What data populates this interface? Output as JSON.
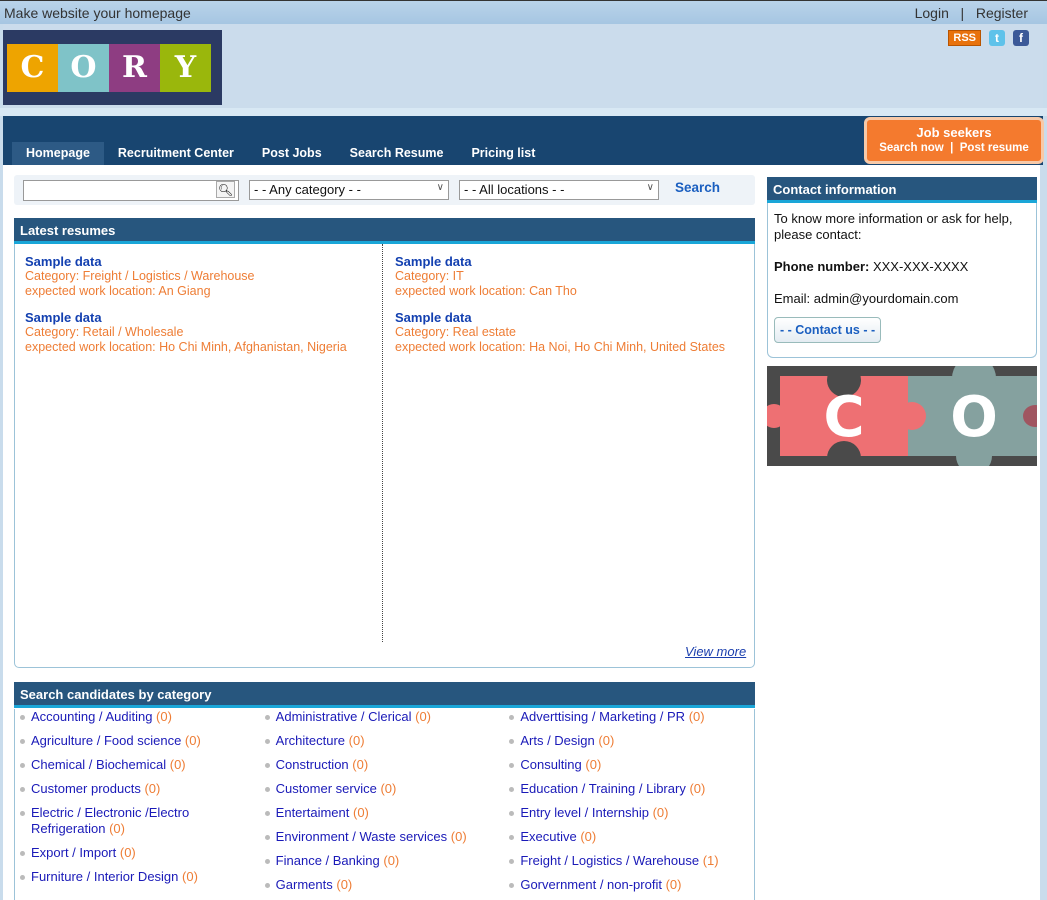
{
  "topbar": {
    "homepage_link": "Make website your homepage",
    "login": "Login",
    "separator": "|",
    "register": "Register"
  },
  "logo": {
    "letters": [
      "C",
      "O",
      "R",
      "Y"
    ],
    "colors": [
      "#eea400",
      "#7fc3c8",
      "#8e3d82",
      "#9ab70c"
    ]
  },
  "social": {
    "rss": "RSS",
    "twitter": "t",
    "facebook": "f"
  },
  "nav": {
    "tabs": [
      "Homepage",
      "Recruitment Center",
      "Post Jobs",
      "Search Resume",
      "Pricing list"
    ],
    "active": "Homepage"
  },
  "job_seekers": {
    "title": "Job seekers",
    "search_now": "Search now",
    "separator": "|",
    "post_resume": "Post resume"
  },
  "search": {
    "keyword_value": "",
    "category": "- - Any category - -",
    "location": "- - All locations - -",
    "button": "Search"
  },
  "latest_resumes": {
    "title": "Latest resumes",
    "items": [
      {
        "name": "Sample data",
        "category": "Category: Freight / Logistics / Warehouse",
        "location": "expected work location: An Giang"
      },
      {
        "name": "Sample data",
        "category": "Category: IT",
        "location": "expected work location: Can Tho"
      },
      {
        "name": "Sample data",
        "category": "Category: Retail / Wholesale",
        "location": "expected work location: Ho Chi Minh, Afghanistan, Nigeria"
      },
      {
        "name": "Sample data",
        "category": "Category: Real estate",
        "location": "expected work location: Ha Noi, Ho Chi Minh, United States"
      }
    ],
    "view_more": "View more"
  },
  "categories": {
    "title": "Search candidates by category",
    "columns": [
      [
        {
          "name": "Accounting / Auditing",
          "count": "(0)"
        },
        {
          "name": "Agriculture / Food science",
          "count": "(0)"
        },
        {
          "name": "Chemical / Biochemical",
          "count": "(0)"
        },
        {
          "name": "Customer products",
          "count": "(0)"
        },
        {
          "name": "Electric / Electronic /Electro Refrigeration",
          "count": "(0)"
        },
        {
          "name": "Export / Import",
          "count": "(0)"
        },
        {
          "name": "Furniture / Interior Design",
          "count": "(0)"
        }
      ],
      [
        {
          "name": "Administrative / Clerical",
          "count": "(0)"
        },
        {
          "name": "Architecture",
          "count": "(0)"
        },
        {
          "name": "Construction",
          "count": "(0)"
        },
        {
          "name": "Customer service",
          "count": "(0)"
        },
        {
          "name": "Entertaiment",
          "count": "(0)"
        },
        {
          "name": "Environment / Waste services",
          "count": "(0)"
        },
        {
          "name": "Finance / Banking",
          "count": "(0)"
        },
        {
          "name": "Garments",
          "count": "(0)"
        }
      ],
      [
        {
          "name": "Adverttising / Marketing / PR",
          "count": "(0)"
        },
        {
          "name": "Arts / Design",
          "count": "(0)"
        },
        {
          "name": "Consulting",
          "count": "(0)"
        },
        {
          "name": "Education / Training / Library",
          "count": "(0)"
        },
        {
          "name": "Entry level / Internship",
          "count": "(0)"
        },
        {
          "name": "Executive",
          "count": "(0)"
        },
        {
          "name": "Freight / Logistics / Warehouse",
          "count": "(1)"
        },
        {
          "name": "Gorvernment / non-profit",
          "count": "(0)"
        }
      ]
    ]
  },
  "contact": {
    "title": "Contact information",
    "intro": "To know more information or ask for help, please contact:",
    "phone_label": "Phone number:",
    "phone": "XXX-XXX-XXXX",
    "email": "Email: admin@yourdomain.com",
    "button": "- - Contact us - -"
  },
  "banner": {
    "letters": [
      "C",
      "O"
    ]
  }
}
